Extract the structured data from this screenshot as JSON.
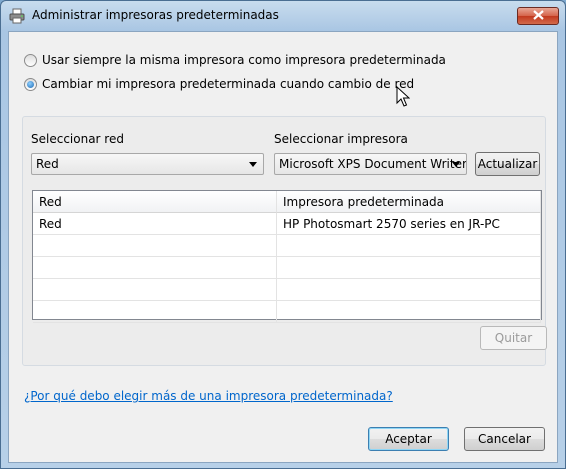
{
  "window": {
    "title": "Administrar impresoras predeterminadas",
    "close_label": "X"
  },
  "options": [
    {
      "label": "Usar siempre la misma impresora como impresora predeterminada",
      "selected": false
    },
    {
      "label": "Cambiar mi impresora predeterminada cuando cambio de red",
      "selected": true
    }
  ],
  "network": {
    "label": "Seleccionar red",
    "value": "Red"
  },
  "printer": {
    "label": "Seleccionar impresora",
    "value": "Microsoft XPS Document Writer",
    "update_label": "Actualizar"
  },
  "table": {
    "columns": [
      "Red",
      "Impresora predeterminada"
    ],
    "rows": [
      [
        "Red",
        "HP Photosmart 2570 series en JR-PC"
      ],
      [
        "",
        ""
      ],
      [
        "",
        ""
      ],
      [
        "",
        ""
      ],
      [
        "",
        ""
      ]
    ]
  },
  "remove_label": "Quitar",
  "help_link": "¿Por qué debo elegir más de una impresora predeterminada?",
  "footer": {
    "accept_label": "Aceptar",
    "cancel_label": "Cancelar"
  },
  "icons": {
    "title": "printer-icon",
    "close": "close-icon",
    "dropdown": "chevron-down-icon",
    "cursor": "mouse-pointer-icon"
  }
}
